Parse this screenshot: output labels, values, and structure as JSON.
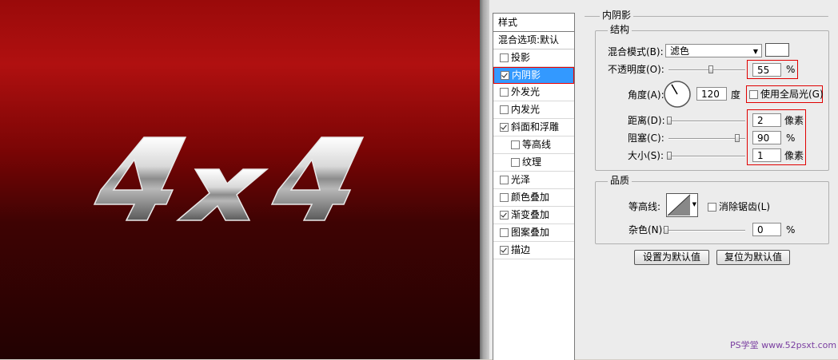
{
  "canvas": {
    "logo_text": "4x4"
  },
  "style_list": {
    "header": "样式",
    "blend_options": "混合选项:默认",
    "items": [
      {
        "label": "投影",
        "checked": false,
        "sub": false,
        "selected": false
      },
      {
        "label": "内阴影",
        "checked": true,
        "sub": false,
        "selected": true
      },
      {
        "label": "外发光",
        "checked": false,
        "sub": false,
        "selected": false
      },
      {
        "label": "内发光",
        "checked": false,
        "sub": false,
        "selected": false
      },
      {
        "label": "斜面和浮雕",
        "checked": true,
        "sub": false,
        "selected": false
      },
      {
        "label": "等高线",
        "checked": false,
        "sub": true,
        "selected": false
      },
      {
        "label": "纹理",
        "checked": false,
        "sub": true,
        "selected": false
      },
      {
        "label": "光泽",
        "checked": false,
        "sub": false,
        "selected": false
      },
      {
        "label": "颜色叠加",
        "checked": false,
        "sub": false,
        "selected": false
      },
      {
        "label": "渐变叠加",
        "checked": true,
        "sub": false,
        "selected": false
      },
      {
        "label": "图案叠加",
        "checked": false,
        "sub": false,
        "selected": false
      },
      {
        "label": "描边",
        "checked": true,
        "sub": false,
        "selected": false
      }
    ]
  },
  "panel": {
    "title": "内阴影",
    "structure": {
      "title": "结构",
      "blend_mode_label": "混合模式(B):",
      "blend_mode_value": "滤色",
      "blend_color": "#ffffff",
      "opacity_label": "不透明度(O):",
      "opacity_value": "55",
      "opacity_unit": "%",
      "opacity_level": 0.55,
      "angle_label": "角度(A):",
      "angle_value": "120",
      "angle_unit": "度",
      "global_light_label": "使用全局光(G)",
      "global_light_checked": false,
      "distance_label": "距离(D):",
      "distance_value": "2",
      "distance_unit": "像素",
      "choke_label": "阻塞(C):",
      "choke_value": "90",
      "choke_unit": "%",
      "choke_level": 0.9,
      "size_label": "大小(S):",
      "size_value": "1",
      "size_unit": "像素"
    },
    "quality": {
      "title": "品质",
      "contour_label": "等高线:",
      "anti_alias_label": "消除锯齿(L)",
      "anti_alias_checked": false,
      "noise_label": "杂色(N):",
      "noise_value": "0",
      "noise_unit": "%"
    },
    "buttons": {
      "set_default": "设置为默认值",
      "reset_default": "复位为默认值"
    }
  },
  "watermark": "PS学堂 www.52psxt.com"
}
